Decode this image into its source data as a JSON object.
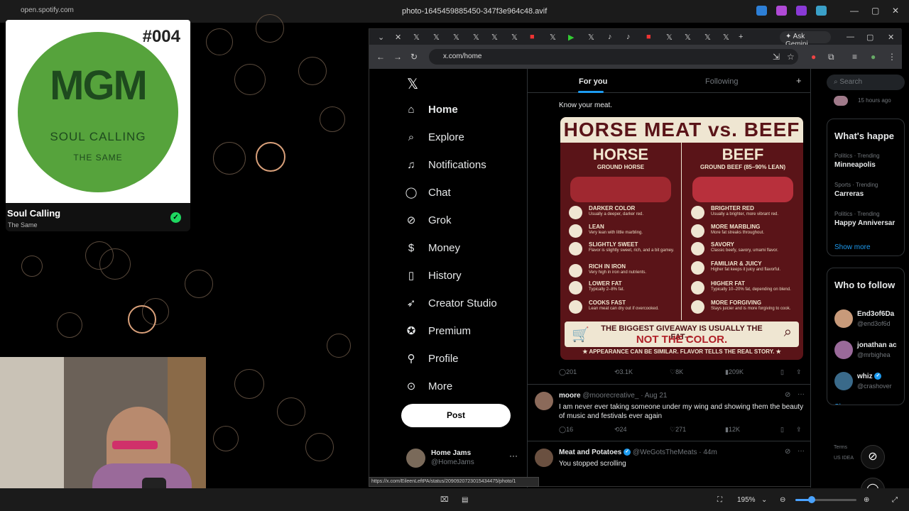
{
  "viewer": {
    "url": "open.spotify.com",
    "filename": "photo-1645459885450-347f3e964c48.avif",
    "zoom": "195%",
    "status_url": "https://x.com/EileenLeftPA/status/2090920723015434475/photo/1"
  },
  "spotify": {
    "number": "#004",
    "logo": "MGM",
    "cover_title": "SOUL CALLING",
    "cover_sub": "THE SAME",
    "track": "Soul Calling",
    "artist": "The Same",
    "accent": "#1ed760"
  },
  "browser": {
    "address": "x.com/home",
    "gemini": "Ask Gemini"
  },
  "nav": {
    "items": [
      {
        "label": "Home",
        "icon": "home-icon"
      },
      {
        "label": "Explore",
        "icon": "search-icon"
      },
      {
        "label": "Notifications",
        "icon": "bell-icon"
      },
      {
        "label": "Chat",
        "icon": "chat-icon"
      },
      {
        "label": "Grok",
        "icon": "grok-icon"
      },
      {
        "label": "Money",
        "icon": "money-icon"
      },
      {
        "label": "History",
        "icon": "bookmark-icon"
      },
      {
        "label": "Creator Studio",
        "icon": "rocket-icon"
      },
      {
        "label": "Premium",
        "icon": "verified-icon"
      },
      {
        "label": "Profile",
        "icon": "person-icon"
      },
      {
        "label": "More",
        "icon": "more-icon"
      }
    ],
    "post": "Post",
    "account": {
      "name": "Home Jams",
      "handle": "@HomeJams"
    }
  },
  "feed": {
    "tab_foryou": "For you",
    "tab_following": "Following",
    "tweet1": {
      "text": "Know your meat.",
      "replies": "201",
      "retweets": "3.1K",
      "likes": "8K",
      "views": "209K"
    },
    "tweet2": {
      "name": "moore",
      "handle": "@moorecreative_ · Aug 21",
      "text": "I am never ever taking someone under my wing and showing them the beauty of music and festivals ever again",
      "replies": "16",
      "retweets": "24",
      "likes": "271",
      "views": "12K"
    },
    "tweet3": {
      "name": "Meat and Potatoes",
      "handle": "@WeGotsTheMeats · 44m",
      "text": "You stopped scrolling"
    }
  },
  "infographic": {
    "title": "HORSE MEAT vs. BEEF",
    "horse": "HORSE",
    "horse_sub": "GROUND HORSE",
    "beef": "BEEF",
    "beef_sub": "GROUND BEEF (85–90% LEAN)",
    "horse_attrs": [
      {
        "t": "DARKER COLOR",
        "d": "Usually a deeper, darker red."
      },
      {
        "t": "LEAN",
        "d": "Very lean with little marbling."
      },
      {
        "t": "SLIGHTLY SWEET",
        "d": "Flavor is slightly sweet, rich, and a bit gamey."
      },
      {
        "t": "RICH IN IRON",
        "d": "Very high in iron and nutrients."
      },
      {
        "t": "LOWER FAT",
        "d": "Typically 2–8% fat."
      },
      {
        "t": "COOKS FAST",
        "d": "Lean meat can dry out if overcooked."
      }
    ],
    "beef_attrs": [
      {
        "t": "BRIGHTER RED",
        "d": "Usually a brighter, more vibrant red."
      },
      {
        "t": "MORE MARBLING",
        "d": "More fat streaks throughout."
      },
      {
        "t": "SAVORY",
        "d": "Classic beefy, savory, umami flavor."
      },
      {
        "t": "FAMILIAR & JUICY",
        "d": "Higher fat keeps it juicy and flavorful."
      },
      {
        "t": "HIGHER FAT",
        "d": "Typically 10–20% fat, depending on blend."
      },
      {
        "t": "MORE FORGIVING",
        "d": "Stays juicier and is more forgiving to cook."
      }
    ],
    "bar1": "THE BIGGEST GIVEAWAY IS USUALLY THE FAT—",
    "bar2": "NOT THE COLOR.",
    "footer": "★ APPEARANCE CAN BE SIMILAR. FLAVOR TELLS THE REAL STORY. ★"
  },
  "right": {
    "search": "Search",
    "ago": "15 hours ago",
    "happening": "What's happe",
    "trends": [
      {
        "c": "Politics · Trending",
        "t": "Minneapolis"
      },
      {
        "c": "Sports · Trending",
        "t": "Carreras"
      },
      {
        "c": "Politics · Trending",
        "t": "Happy Anniversar"
      }
    ],
    "show_more": "Show more",
    "who": "Who to follow",
    "follows": [
      {
        "n": "End3of6Da",
        "h": "@end3of6d"
      },
      {
        "n": "jonathan ac",
        "h": "@mrbighea"
      },
      {
        "n": "whiz",
        "h": "@crashover"
      }
    ],
    "terms": "Terms",
    "us": "US IDEA"
  }
}
